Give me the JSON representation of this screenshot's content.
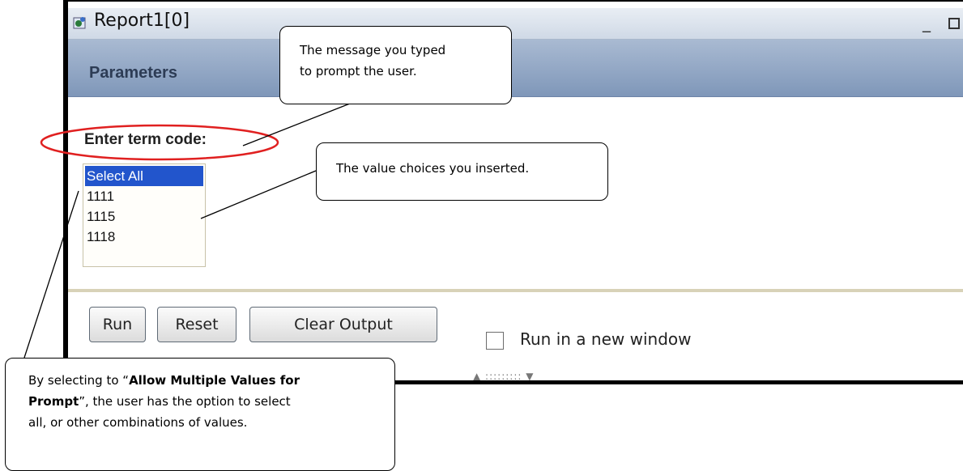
{
  "window": {
    "title": "Report1[0]",
    "minimize_glyph": "_",
    "parameters_header": "Parameters"
  },
  "prompt": {
    "label": "Enter term code:",
    "options": [
      {
        "label": "Select All",
        "selected": true
      },
      {
        "label": "1111",
        "selected": false
      },
      {
        "label": "1115",
        "selected": false
      },
      {
        "label": "1118",
        "selected": false
      }
    ]
  },
  "buttons": {
    "run": "Run",
    "reset": "Reset",
    "clear_output": "Clear Output"
  },
  "checkbox": {
    "label": "Run in a new window",
    "checked": false
  },
  "splitter_grip": "▲ ::::::::: ▼",
  "callouts": {
    "message": {
      "line1": "The message you typed",
      "line2": "to prompt the user."
    },
    "values": "The value choices you inserted.",
    "multiple": {
      "text1": "By selecting to “",
      "bold1": "Allow Multiple Values for",
      "bold2": "Prompt",
      "text2": "”, the user has the option to select",
      "text3": "all, or other combinations of values."
    }
  },
  "colors": {
    "highlight_ellipse": "#e02020",
    "selected_option": "#2255cc",
    "param_header": "#8fa5c4"
  }
}
